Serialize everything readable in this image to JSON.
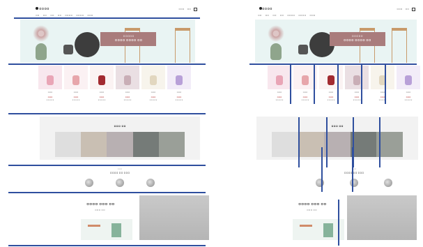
{
  "header": {
    "logo": "ㅁㅁㅁㅁ",
    "nav": [
      "ㅁㅁ",
      "ㅁㅁ",
      "ㅁㅁ",
      "ㅁㅁ",
      "ㅁㅁㅁㅁ",
      "ㅁㅁㅁㅁ",
      "ㅁㅁㅁ"
    ],
    "util": [
      "ㅁㅁㅁ",
      "ㅁㅁ"
    ]
  },
  "hero": {
    "banner_sub": "ㅁㅁㅁㅁㅁ",
    "banner_main": "ㅁㅁㅁㅁ ㅁㅁㅁㅁ ㅁㅁ"
  },
  "products": [
    {
      "bottle": "#e9a5b6",
      "name": "ㅁㅁㅁ",
      "price": "ㅁㅁㅁ"
    },
    {
      "bottle": "#e7a6ab",
      "name": "ㅁㅁㅁ",
      "price": "ㅁㅁㅁ"
    },
    {
      "bottle": "#a22a30",
      "name": "ㅁㅁㅁ",
      "price": "ㅁㅁㅁ"
    },
    {
      "bottle": "#c9aeb6",
      "name": "ㅁㅁㅁ",
      "price": "ㅁㅁㅁ"
    },
    {
      "bottle": "#e2d7bf",
      "name": "ㅁㅁㅁ",
      "price": "ㅁㅁㅁ"
    },
    {
      "bottle": "#b8a0d8",
      "name": "ㅁㅁㅁ",
      "price": "ㅁㅁㅁ"
    }
  ],
  "trend": {
    "title": "ㅁㅁㅁ ㅁㅁ"
  },
  "review": {
    "tiny": "ㅁㅁㅁ",
    "title": "ㅁㅁㅁㅁ ㅁㅁ ㅁㅁㅁ"
  },
  "simple": {
    "heading": "ㅁㅁㅁㅁ ㅁㅁㅁ ㅁㅁ",
    "subheading": "ㅁㅁㅁ ㅁㅁ"
  }
}
